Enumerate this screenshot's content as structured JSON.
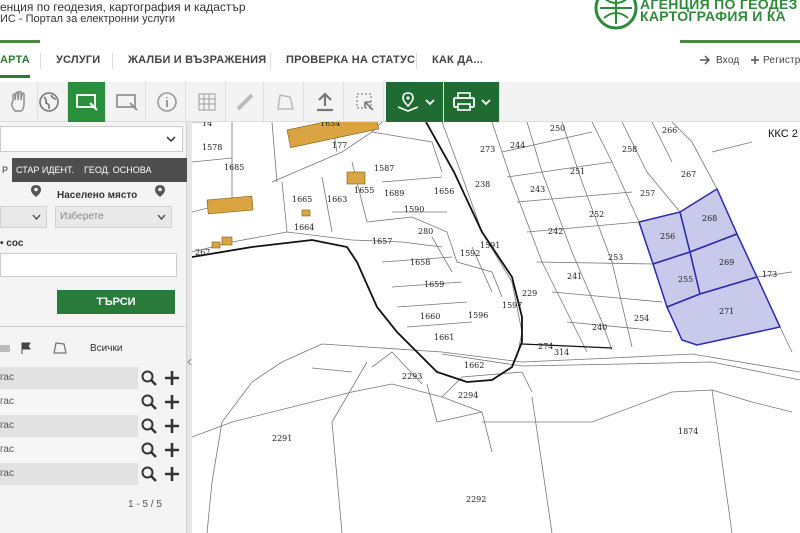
{
  "header": {
    "agency_line": "енция по геодезия, картография и кадастър",
    "portal_line": "ИС - Портал за електронни услуги",
    "agency_title_1": "АГЕНЦИЯ ПО ГЕОДЕЗ",
    "agency_title_2": "КАРТОГРАФИЯ И КА"
  },
  "nav": {
    "items": [
      "АРТА",
      "УСЛУГИ",
      "ЖАЛБИ И ВЪЗРАЖЕНИЯ",
      "ПРОВЕРКА НА СТАТУС",
      "КАК ДА..."
    ],
    "login": "Вход",
    "register": "Регистр"
  },
  "sidebar": {
    "tabs": [
      "Р",
      "СТАР ИДЕНТ.",
      "ГЕОД. ОСНОВА"
    ],
    "settlement_label": "Населено място",
    "choose_placeholder": "Изберете",
    "field_label": "• сос",
    "search_label": "ТЪРСИ",
    "all_label": "Всички",
    "results": [
      "гас",
      "гас",
      "гас",
      "гас",
      "гас"
    ],
    "pager": "1 - 5 / 5"
  },
  "map": {
    "sheet_label": "ККС 2",
    "parcels": [
      "1578",
      "1685",
      "1654",
      "177",
      "1587",
      "1655",
      "1665",
      "1663",
      "1689",
      "1656",
      "1664",
      "1590",
      "280",
      "1657",
      "1658",
      "1592",
      "1591",
      "1659",
      "1660",
      "1596",
      "1597",
      "1661",
      "1662",
      "2293",
      "2294",
      "2291",
      "2292",
      "267",
      "273",
      "238",
      "244",
      "250",
      "243",
      "251",
      "242",
      "252",
      "241",
      "253",
      "240",
      "254",
      "229",
      "274",
      "314",
      "258",
      "266",
      "257",
      "267",
      "256",
      "268",
      "255",
      "269",
      "271",
      "173",
      "1874",
      "14"
    ],
    "highlight_color": "#c9c9ec",
    "highlight_border": "#2b2bb0"
  },
  "colors": {
    "brand_green": "#2a8f3c",
    "brand_dark_green": "#1f6b32",
    "building_fill": "#d9a441"
  }
}
